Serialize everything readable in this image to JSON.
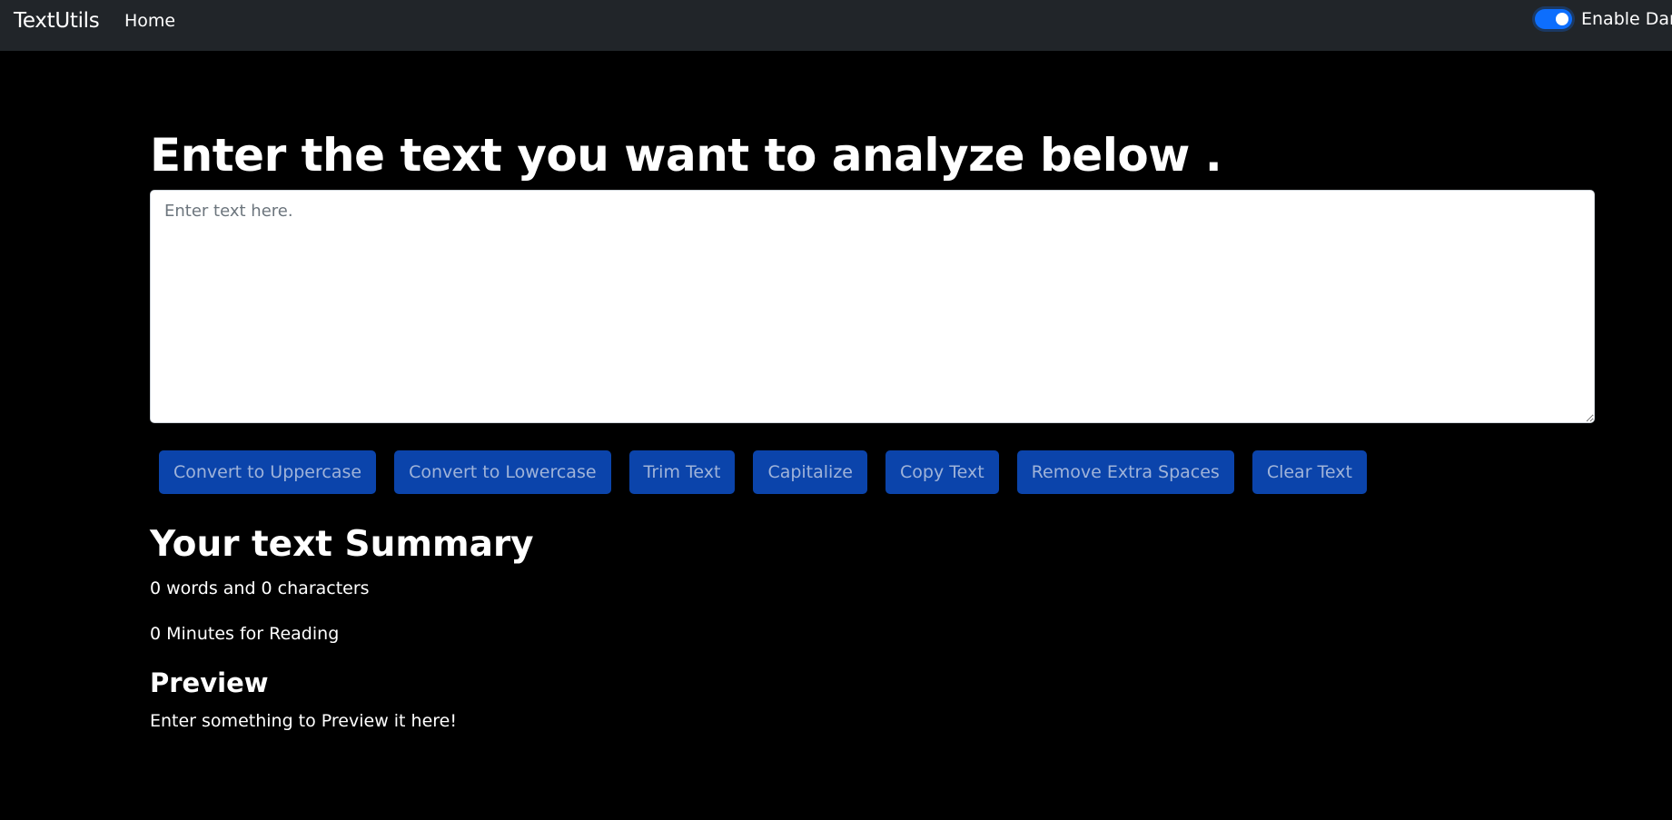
{
  "navbar": {
    "brand": "TextUtils",
    "home_label": "Home",
    "dark_mode_toggle": {
      "label": "Enable Dark",
      "enabled": true
    }
  },
  "main": {
    "heading": "Enter the text you want to analyze below .",
    "textarea": {
      "placeholder": "Enter text here.",
      "value": ""
    },
    "buttons": [
      "Convert to Uppercase",
      "Convert to Lowercase",
      "Trim Text",
      "Capitalize",
      "Copy Text",
      "Remove Extra Spaces",
      "Clear Text"
    ]
  },
  "summary": {
    "title": "Your text Summary",
    "counts": "0 words and 0 characters",
    "reading_time": "0 Minutes for Reading"
  },
  "preview": {
    "title": "Preview",
    "text": "Enter something to Preview it here!"
  },
  "colors": {
    "navbar_bg": "#212529",
    "page_bg": "#000000",
    "button_bg": "#0b44ab",
    "toggle_accent": "#0d6efd"
  }
}
